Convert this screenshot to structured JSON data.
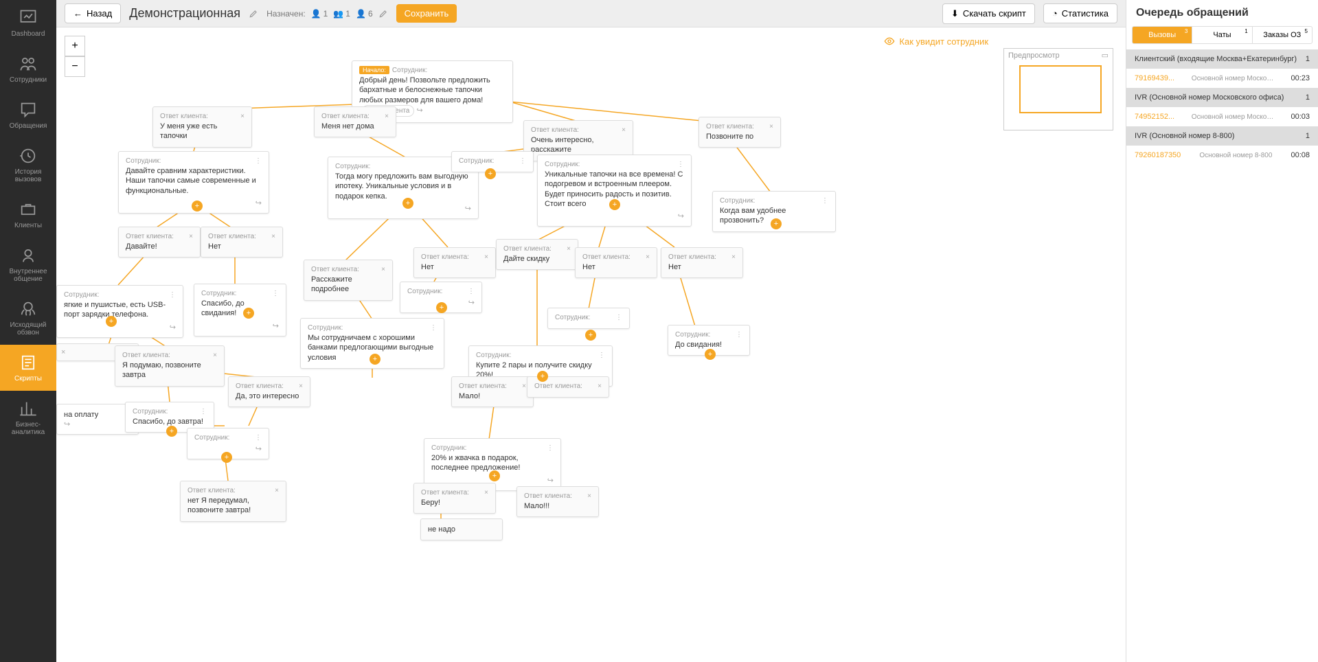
{
  "sidebar": {
    "items": [
      {
        "label": "Dashboard"
      },
      {
        "label": "Сотрудники"
      },
      {
        "label": "Обращения"
      },
      {
        "label": "История вызовов"
      },
      {
        "label": "Клиенты"
      },
      {
        "label": "Внутреннее общение"
      },
      {
        "label": "Исходящий обзвон"
      },
      {
        "label": "Скрипты"
      },
      {
        "label": "Бизнес-аналитика"
      }
    ]
  },
  "topbar": {
    "back": "Назад",
    "title": "Демонстрационная",
    "assigned_label": "Назначен:",
    "count1": "1",
    "count2": "1",
    "count3": "6",
    "save": "Сохранить",
    "download": "Скачать скрипт",
    "stats": "Статистика"
  },
  "preview_hint": "Как увидит сотрудник",
  "minimap_label": "Предпросмотр",
  "labels": {
    "employee": "Сотрудник:",
    "client": "Ответ клиента:",
    "start": "Начало:",
    "fio": "ФИО клиента"
  },
  "nodes": {
    "start": "Добрый день! Позвольте предложить бархатные и белоснежные тапочки любых размеров для вашего дома!",
    "c1": "У меня уже есть тапочки",
    "c2": "Меня нет дома",
    "c3": "Очень интересно, расскажите",
    "c4": "Позвоните по",
    "e1": "Давайте сравним характеристики. Наши тапочки самые современные и функциональные.",
    "e2": "Тогда могу предложить вам выгодную ипотеку. Уникальные условия и в подарок кепка.",
    "e3": "",
    "e4": "Уникальные тапочки на все времена! С подогревом и встроенным плеером. Будет приносить радость и позитив. Стоит всего",
    "e5": "Когда вам удобнее прозвонить?",
    "c5": "Давайте!",
    "c6": "Нет",
    "c7": "Расскажите подробнее",
    "c8": "Дайте скидку",
    "c9": "Нет",
    "c10": "Нет",
    "c11": "Нет",
    "e6": "ягкие и пушистые, есть USB-порт зарядки телефона.",
    "e7": "Спасибо, до свидания!",
    "e8": "",
    "e9": "Мы сотрудничаем с хорошими банками предлогающими выгодные условия",
    "e10": "Купите 2 пары и получите скидку 20%!",
    "e11": "До свидания!",
    "e12": "",
    "c12": "Я подумаю, позвоните завтра",
    "c13": "Да, это интересно",
    "c14": "Мало!",
    "c15": "",
    "e13": "Спасибо, до завтра!",
    "e14": "",
    "e15": "на оплату",
    "e16": "20% и жвачка в подарок, последнее предложение!",
    "c16": "нет Я передумал, позвоните завтра!",
    "c17": "Беру!",
    "c18": "Мало!!!",
    "c19": "не надо"
  },
  "queue": {
    "title": "Очередь обращений",
    "tabs": [
      {
        "label": "Вызовы",
        "badge": "3"
      },
      {
        "label": "Чаты",
        "badge": "1"
      },
      {
        "label": "Заказы ОЗ",
        "badge": "5"
      }
    ],
    "rows": [
      {
        "type": "header",
        "text": "Клиентский (входящие Москва+Екатеринбург)",
        "count": "1"
      },
      {
        "type": "call",
        "num": "79169439...",
        "sub": "Основной номер Московского офи...",
        "time": "00:23"
      },
      {
        "type": "header",
        "text": "IVR  (Основной номер Московского офиса)",
        "count": "1"
      },
      {
        "type": "call",
        "num": "74952152...",
        "sub": "Основной номер Московского оф...",
        "time": "00:03"
      },
      {
        "type": "header",
        "text": "IVR  (Основной номер 8-800)",
        "count": "1"
      },
      {
        "type": "call",
        "num": "79260187350",
        "sub": "Основной номер 8-800",
        "time": "00:08"
      }
    ]
  }
}
